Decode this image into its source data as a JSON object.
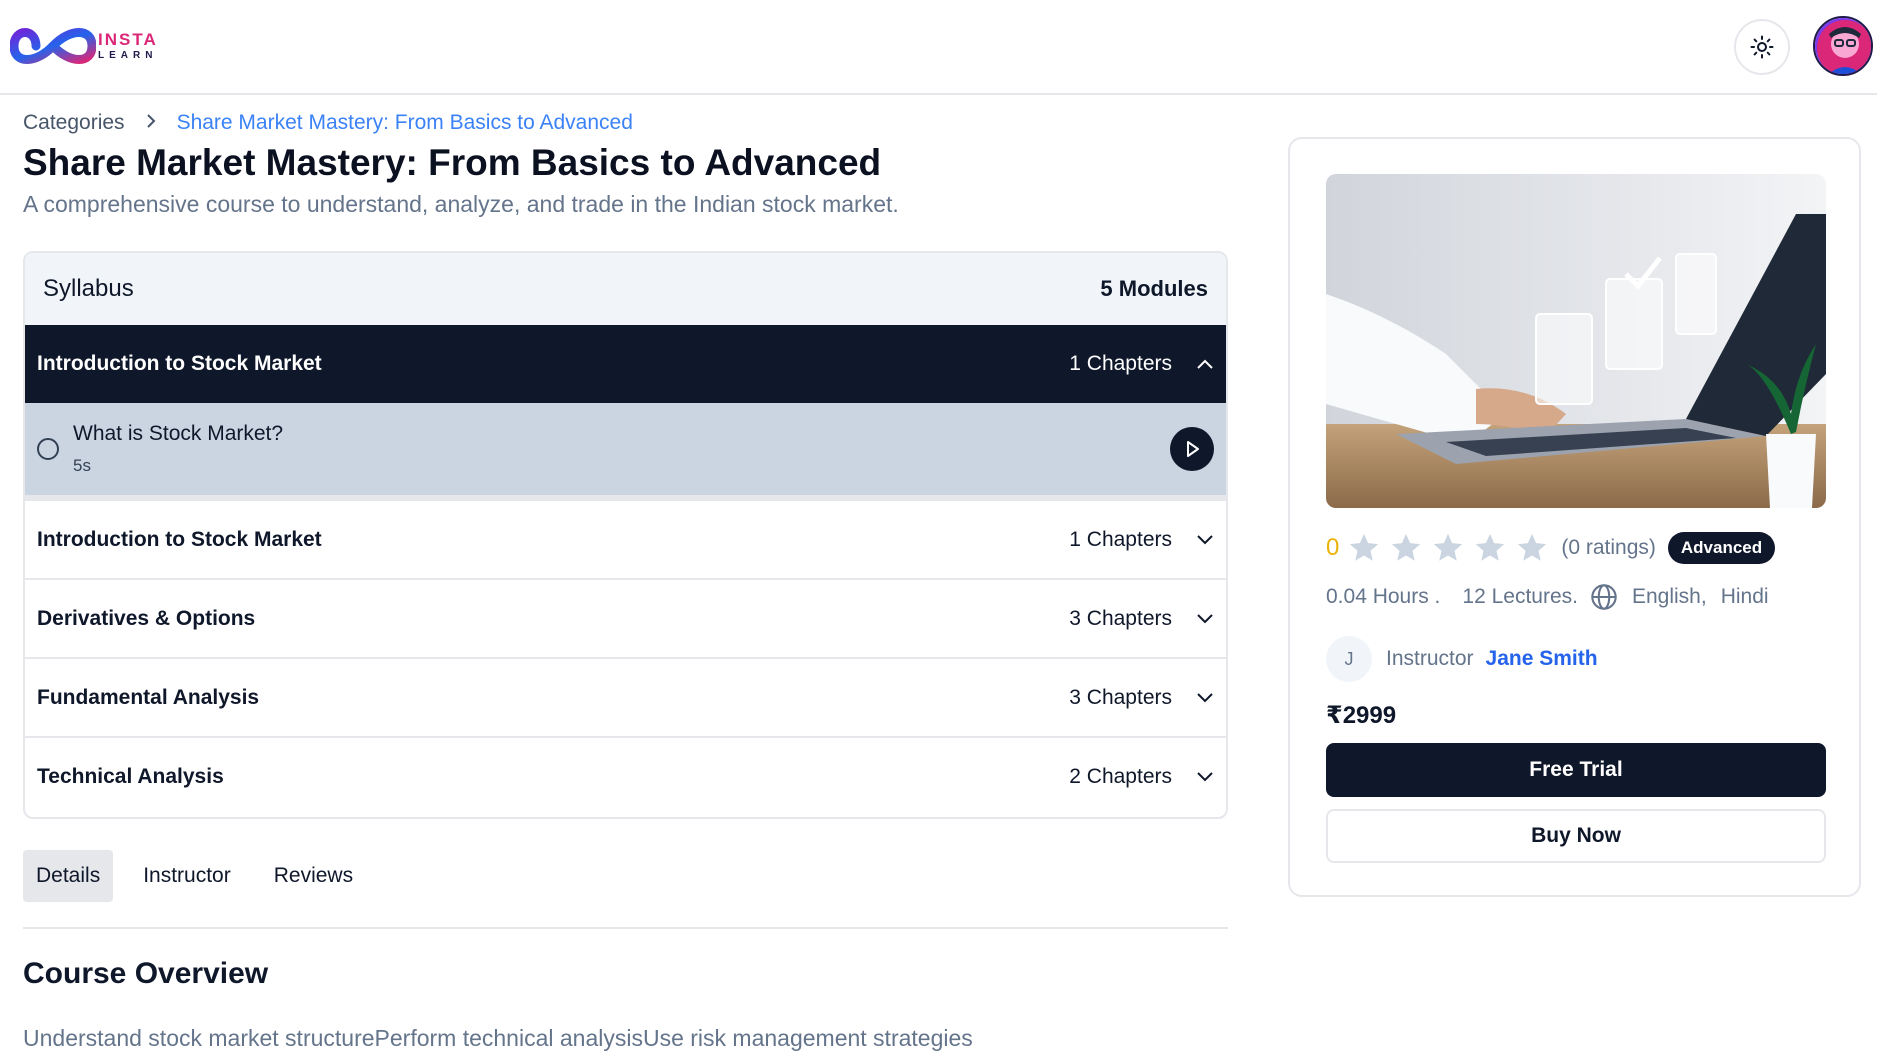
{
  "brand": {
    "line1": "INSTA",
    "line2": "LEARN"
  },
  "header": {
    "theme_icon": "sun-icon",
    "avatar_icon": "user-avatar"
  },
  "breadcrumb": {
    "root": "Categories",
    "current": "Share Market Mastery: From Basics to Advanced"
  },
  "course": {
    "title": "Share Market Mastery: From Basics to Advanced",
    "subtitle": "A comprehensive course to understand, analyze, and trade in the Indian stock market."
  },
  "syllabus": {
    "label": "Syllabus",
    "count": "5 Modules",
    "modules": [
      {
        "title": "Introduction to Stock Market",
        "chapters": "1 Chapters",
        "expanded": true
      },
      {
        "title": "Introduction to Stock Market",
        "chapters": "1 Chapters",
        "expanded": false
      },
      {
        "title": "Derivatives & Options",
        "chapters": "3 Chapters",
        "expanded": false
      },
      {
        "title": "Fundamental Analysis",
        "chapters": "3 Chapters",
        "expanded": false
      },
      {
        "title": "Technical Analysis",
        "chapters": "2 Chapters",
        "expanded": false
      }
    ],
    "open_chapter": {
      "title": "What is Stock Market?",
      "duration": "5s"
    }
  },
  "tabs": [
    {
      "label": "Details",
      "active": true
    },
    {
      "label": "Instructor",
      "active": false
    },
    {
      "label": "Reviews",
      "active": false
    }
  ],
  "overview": {
    "title": "Course Overview",
    "text": "Understand stock market structurePerform technical analysisUse risk management strategies"
  },
  "card": {
    "rating": "0",
    "stars_filled": 0,
    "stars_total": 5,
    "ratings_count": "(0 ratings)",
    "level": "Advanced",
    "hours": "0.04 Hours .",
    "lectures": "12 Lectures.",
    "languages": [
      "English,",
      "Hindi"
    ],
    "instructor_initial": "J",
    "instructor_label": "Instructor",
    "instructor_name": "Jane Smith",
    "price": "₹2999",
    "free_trial_label": "Free Trial",
    "buy_now_label": "Buy Now"
  },
  "colors": {
    "dark": "#0f172a",
    "link": "#3b82f6",
    "star_empty": "#cbd5e1",
    "rating": "#eab308",
    "brand_pink": "#db2777"
  }
}
